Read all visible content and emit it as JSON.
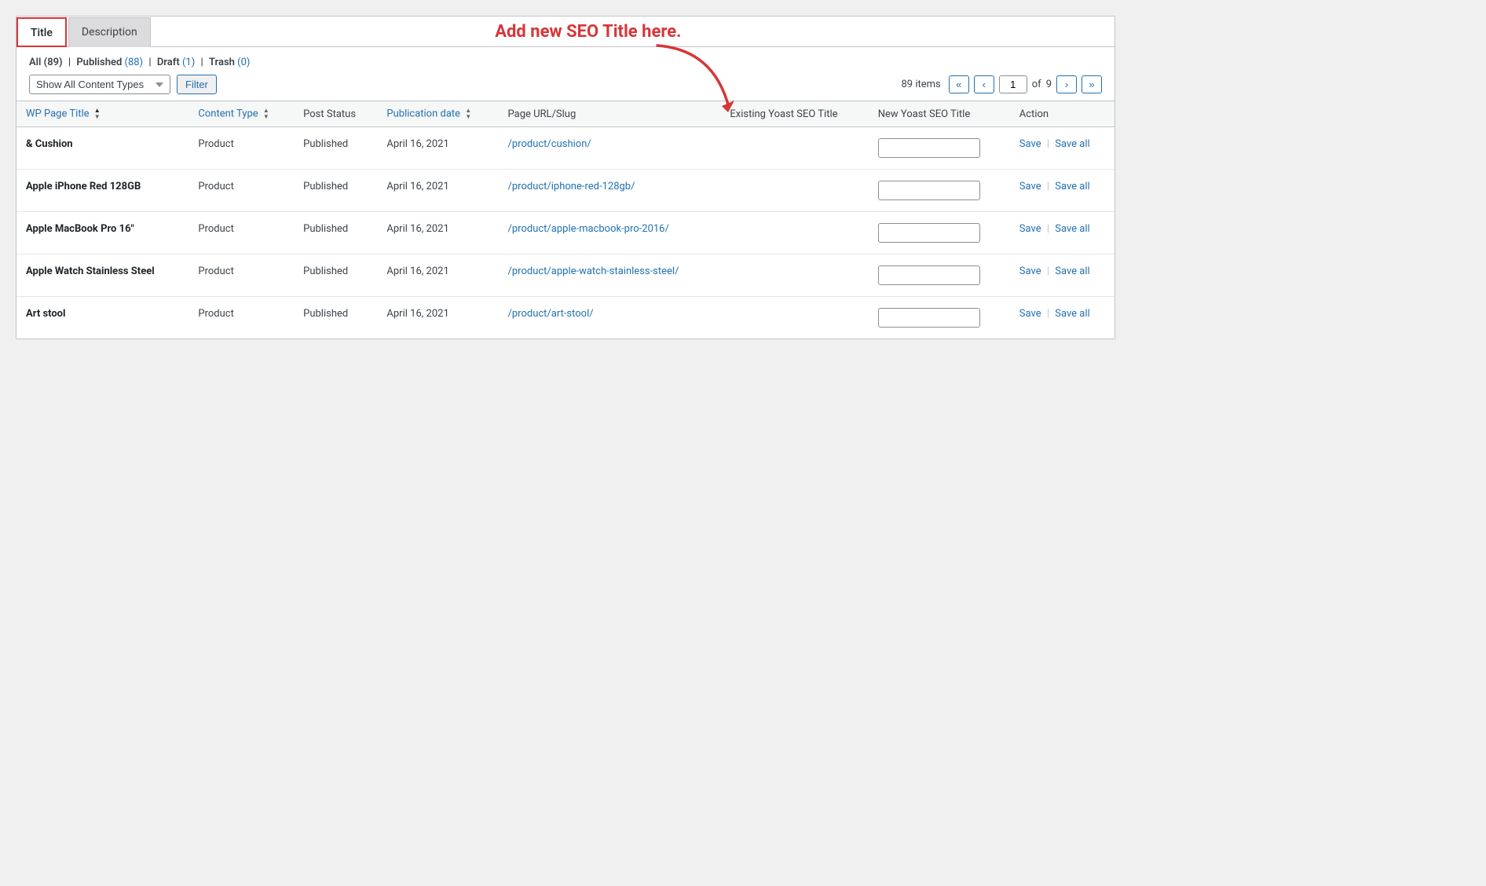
{
  "tabs": [
    {
      "id": "title",
      "label": "Title",
      "active": true
    },
    {
      "id": "description",
      "label": "Description",
      "active": false
    }
  ],
  "status_links": {
    "all": {
      "label": "All",
      "count": 89
    },
    "published": {
      "label": "Published",
      "count": 88
    },
    "draft": {
      "label": "Draft",
      "count": 1
    },
    "trash": {
      "label": "Trash",
      "count": 0
    }
  },
  "filter": {
    "dropdown_label": "Show All Content Types",
    "button_label": "Filter"
  },
  "pagination": {
    "total_items": "89 items",
    "current_page": "1",
    "total_pages": "9",
    "first_label": "«",
    "prev_label": "‹",
    "next_label": "›",
    "last_label": "»",
    "of_label": "of"
  },
  "annotation": {
    "text": "Add new SEO Title here."
  },
  "columns": [
    {
      "id": "wp-title",
      "label": "WP Page Title",
      "sortable": true,
      "sort_active": true
    },
    {
      "id": "content-type",
      "label": "Content Type",
      "sortable": true
    },
    {
      "id": "post-status",
      "label": "Post Status",
      "sortable": false
    },
    {
      "id": "pub-date",
      "label": "Publication date",
      "sortable": true
    },
    {
      "id": "page-url",
      "label": "Page URL/Slug",
      "sortable": false
    },
    {
      "id": "existing-seo",
      "label": "Existing Yoast SEO Title",
      "sortable": false
    },
    {
      "id": "new-seo",
      "label": "New Yoast SEO Title",
      "sortable": false
    },
    {
      "id": "action",
      "label": "Action",
      "sortable": false
    }
  ],
  "rows": [
    {
      "wp_title": "& Cushion",
      "content_type": "Product",
      "post_status": "Published",
      "pub_date": "April 16, 2021",
      "page_url": "/product/cushion/",
      "existing_seo": "",
      "new_seo": "",
      "save_label": "Save",
      "save_all_label": "Save all"
    },
    {
      "wp_title": "Apple iPhone Red 128GB",
      "content_type": "Product",
      "post_status": "Published",
      "pub_date": "April 16, 2021",
      "page_url": "/product/iphone-red-128gb/",
      "existing_seo": "",
      "new_seo": "",
      "save_label": "Save",
      "save_all_label": "Save all"
    },
    {
      "wp_title": "Apple MacBook Pro 16\"",
      "content_type": "Product",
      "post_status": "Published",
      "pub_date": "April 16, 2021",
      "page_url": "/product/apple-macbook-pro-2016/",
      "existing_seo": "",
      "new_seo": "",
      "save_label": "Save",
      "save_all_label": "Save all"
    },
    {
      "wp_title": "Apple Watch Stainless Steel",
      "content_type": "Product",
      "post_status": "Published",
      "pub_date": "April 16, 2021",
      "page_url": "/product/apple-watch-stainless-steel/",
      "existing_seo": "",
      "new_seo": "",
      "save_label": "Save",
      "save_all_label": "Save all"
    },
    {
      "wp_title": "Art stool",
      "content_type": "Product",
      "post_status": "Published",
      "pub_date": "April 16, 2021",
      "page_url": "/product/art-stool/",
      "existing_seo": "",
      "new_seo": "",
      "save_label": "Save",
      "save_all_label": "Save all"
    }
  ]
}
